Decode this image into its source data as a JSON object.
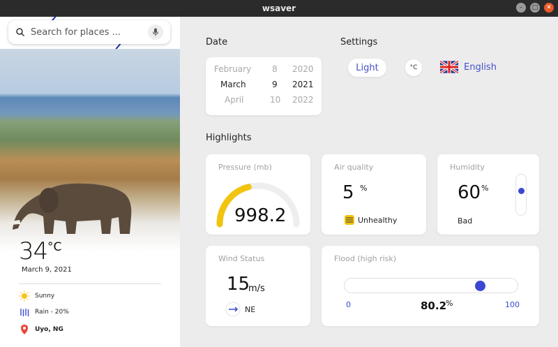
{
  "window": {
    "title": "wsaver"
  },
  "sidebar": {
    "search": {
      "placeholder": "Search for places ..."
    },
    "temperature": "34",
    "temperature_unit": "°C",
    "date": "March 9, 2021",
    "conditions": [
      {
        "icon": "sun-icon",
        "label": "Sunny"
      },
      {
        "icon": "rain-icon",
        "label": "Rain - 20%"
      },
      {
        "icon": "location-pin-icon",
        "label": "Uyo, NG"
      }
    ]
  },
  "date_section": {
    "title": "Date",
    "picker": {
      "months": [
        "February",
        "March",
        "April"
      ],
      "days": [
        "8",
        "9",
        "10"
      ],
      "years": [
        "2020",
        "2021",
        "2022"
      ],
      "selected_index": 1
    }
  },
  "settings": {
    "title": "Settings",
    "theme_label": "Light",
    "unit_label": "°C",
    "language_label": "English",
    "language_flag": "uk-flag-icon"
  },
  "highlights": {
    "title": "Highlights",
    "pressure": {
      "title": "Pressure (mb)",
      "value": "998.2",
      "gauge_fraction": 0.42
    },
    "air_quality": {
      "title": "Air quality",
      "value": "5",
      "unit": "%",
      "status": "Unhealthy",
      "status_icon": "haze-icon"
    },
    "humidity": {
      "title": "Humidity",
      "value": "60",
      "unit": "%",
      "status": "Bad",
      "level_fraction": 0.6
    },
    "wind": {
      "title": "Wind Status",
      "value": "15",
      "unit": "m/s",
      "direction": "NE",
      "direction_icon": "compass-icon"
    },
    "flood": {
      "title": "Flood (high risk)",
      "value": "80.2",
      "unit": "%",
      "min": "0",
      "max": "100",
      "level": 80.2
    }
  },
  "colors": {
    "accent": "#3c47d1",
    "gauge": "#f1c40f",
    "background": "#ececed"
  }
}
